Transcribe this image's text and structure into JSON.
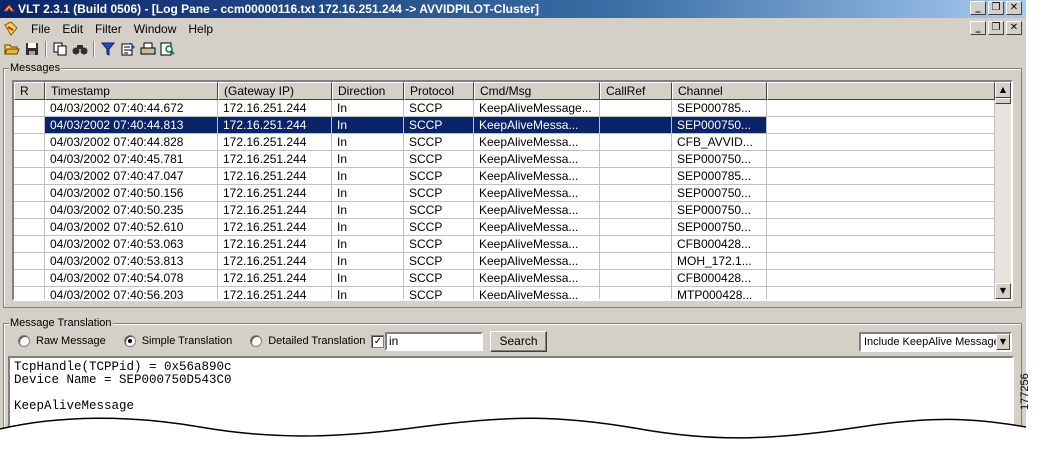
{
  "title_bar": {
    "text": "VLT 2.3.1 (Build 0506) - [Log Pane - ccm00000116.txt   172.16.251.244 -> AVVIDPILOT-Cluster]"
  },
  "menu": [
    "File",
    "Edit",
    "Filter",
    "Window",
    "Help"
  ],
  "toolbar_icons": [
    "open-icon",
    "save-icon",
    "copy-icon",
    "find-icon",
    "filter-icon",
    "edit-filter-icon",
    "print-icon",
    "preview-icon"
  ],
  "messages": {
    "label": "Messages",
    "columns": [
      "R",
      "Timestamp",
      "(Gateway IP)",
      "Direction",
      "Protocol",
      "Cmd/Msg",
      "CallRef",
      "Channel"
    ],
    "rows": [
      [
        "",
        "04/03/2002 07:40:44.672",
        "172.16.251.244",
        "In",
        "SCCP",
        "KeepAliveMessage...",
        "",
        "SEP000785..."
      ],
      [
        "",
        "04/03/2002 07:40:44.813",
        "172.16.251.244",
        "In",
        "SCCP",
        "KeepAliveMessa...",
        "",
        "SEP000750..."
      ],
      [
        "",
        "04/03/2002 07:40:44.828",
        "172.16.251.244",
        "In",
        "SCCP",
        "KeepAliveMessa...",
        "",
        "CFB_AVVID..."
      ],
      [
        "",
        "04/03/2002 07:40:45.781",
        "172.16.251.244",
        "In",
        "SCCP",
        "KeepAliveMessa...",
        "",
        "SEP000750..."
      ],
      [
        "",
        "04/03/2002 07:40:47.047",
        "172.16.251.244",
        "In",
        "SCCP",
        "KeepAliveMessa...",
        "",
        "SEP000785..."
      ],
      [
        "",
        "04/03/2002 07:40:50.156",
        "172.16.251.244",
        "In",
        "SCCP",
        "KeepAliveMessa...",
        "",
        "SEP000750..."
      ],
      [
        "",
        "04/03/2002 07:40:50.235",
        "172.16.251.244",
        "In",
        "SCCP",
        "KeepAliveMessa...",
        "",
        "SEP000750..."
      ],
      [
        "",
        "04/03/2002 07:40:52.610",
        "172.16.251.244",
        "In",
        "SCCP",
        "KeepAliveMessa...",
        "",
        "SEP000750..."
      ],
      [
        "",
        "04/03/2002 07:40:53.063",
        "172.16.251.244",
        "In",
        "SCCP",
        "KeepAliveMessa...",
        "",
        "CFB000428..."
      ],
      [
        "",
        "04/03/2002 07:40:53.813",
        "172.16.251.244",
        "In",
        "SCCP",
        "KeepAliveMessa...",
        "",
        "MOH_172.1..."
      ],
      [
        "",
        "04/03/2002 07:40:54.078",
        "172.16.251.244",
        "In",
        "SCCP",
        "KeepAliveMessa...",
        "",
        "CFB000428..."
      ],
      [
        "",
        "04/03/2002 07:40:56.203",
        "172.16.251.244",
        "In",
        "SCCP",
        "KeepAliveMessa...",
        "",
        "MTP000428..."
      ]
    ],
    "selected_row": 1
  },
  "translation": {
    "label": "Message Translation",
    "modes": [
      "Raw Message",
      "Simple Translation",
      "Detailed Translation"
    ],
    "selected_mode": 1,
    "checkbox_checked": true,
    "search_value": "in",
    "search_button": "Search",
    "dropdown_value": "Include KeepAlive Messages",
    "content": "TcpHandle(TCPPid) = 0x56a890c\nDevice Name = SEP000750D543C0\n\nKeepAliveMessage"
  },
  "figure_id": "177256",
  "colors": {
    "titlebar": "#0a246a",
    "selection": "#0a246a",
    "face": "#d4d0c8"
  }
}
